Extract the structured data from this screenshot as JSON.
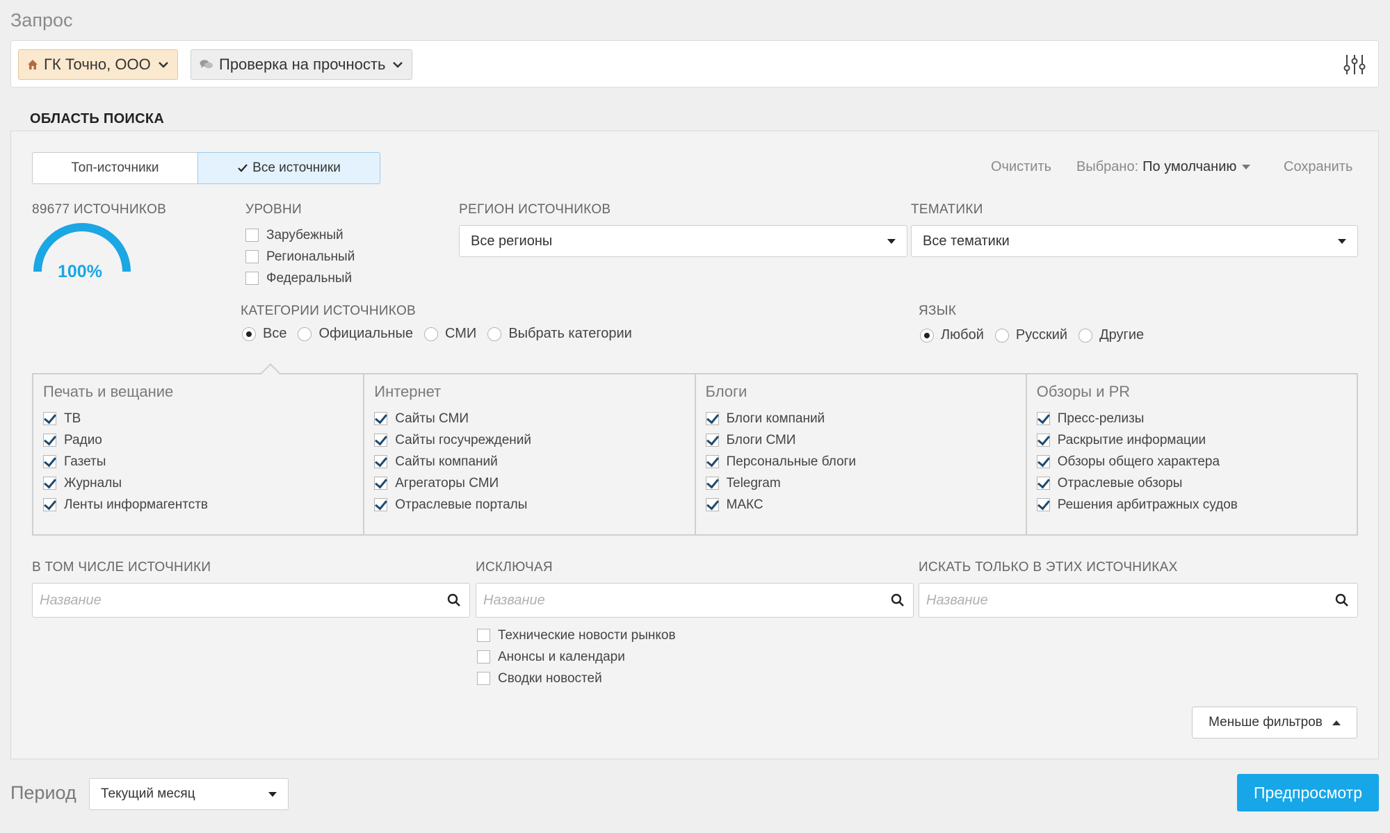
{
  "request": {
    "title": "Запрос",
    "company_pill": "ГК Точно, ООО",
    "query_pill": "Проверка на прочность",
    "icons": {
      "company": "home-icon",
      "query": "chat-bubbles-icon",
      "settings": "sliders-icon"
    }
  },
  "search_area": {
    "title": "ОБЛАСТЬ ПОИСКА",
    "segments": {
      "top": "Топ-источники",
      "all": "Все источники"
    },
    "actions": {
      "clear": "Очистить",
      "selected_prefix": "Выбрано:",
      "selected_value": "По умолчанию",
      "save": "Сохранить"
    },
    "sources_count_label": "89677 ИСТОЧНИКОВ",
    "gauge_percent": "100%",
    "gauge_fraction": 1.0,
    "levels": {
      "label": "УРОВНИ",
      "items": [
        {
          "label": "Зарубежный",
          "checked": false
        },
        {
          "label": "Региональный",
          "checked": false
        },
        {
          "label": "Федеральный",
          "checked": false
        }
      ]
    },
    "region": {
      "label": "РЕГИОН ИСТОЧНИКОВ",
      "value": "Все регионы"
    },
    "topics": {
      "label": "ТЕМАТИКИ",
      "value": "Все тематики"
    },
    "categories": {
      "label": "КАТЕГОРИИ ИСТОЧНИКОВ",
      "options": [
        "Все",
        "Официальные",
        "СМИ",
        "Выбрать категории"
      ],
      "selected": 0
    },
    "language": {
      "label": "ЯЗЫК",
      "options": [
        "Любой",
        "Русский",
        "Другие"
      ],
      "selected": 0
    },
    "category_groups": [
      {
        "title": "Печать и вещание",
        "items": [
          "ТВ",
          "Радио",
          "Газеты",
          "Журналы",
          "Ленты информагентств"
        ]
      },
      {
        "title": "Интернет",
        "items": [
          "Сайты СМИ",
          "Сайты госучреждений",
          "Сайты компаний",
          "Агрегаторы СМИ",
          "Отраслевые порталы"
        ]
      },
      {
        "title": "Блоги",
        "items": [
          "Блоги компаний",
          "Блоги СМИ",
          "Персональные блоги",
          "Telegram",
          "МАКС"
        ]
      },
      {
        "title": "Обзоры и PR",
        "items": [
          "Пресс-релизы",
          "Раскрытие информации",
          "Обзоры общего характера",
          "Отраслевые обзоры",
          "Решения арбитражных судов"
        ]
      }
    ],
    "include": {
      "label": "В ТОМ ЧИСЛЕ ИСТОЧНИКИ",
      "placeholder": "Название"
    },
    "exclude": {
      "label": "ИСКЛЮЧАЯ",
      "placeholder": "Название",
      "options": [
        {
          "label": "Технические новости рынков",
          "checked": false
        },
        {
          "label": "Анонсы и календари",
          "checked": false
        },
        {
          "label": "Сводки новостей",
          "checked": false
        }
      ]
    },
    "only": {
      "label": "ИСКАТЬ ТОЛЬКО В ЭТИХ ИСТОЧНИКАХ",
      "placeholder": "Название"
    },
    "less_filters": "Меньше фильтров"
  },
  "period": {
    "label": "Период",
    "value": "Текущий месяц"
  },
  "preview_button": "Предпросмотр",
  "colors": {
    "accent": "#17a6e8",
    "company_pill_bg": "#fbe9cf",
    "check": "#1f4a6e"
  }
}
